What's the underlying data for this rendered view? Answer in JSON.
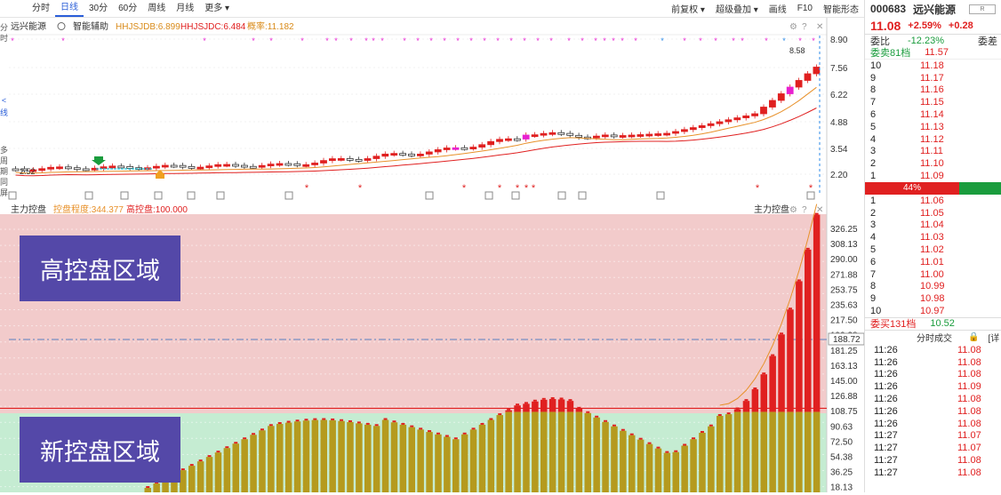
{
  "toolbar": {
    "tabs": [
      "分时",
      "日线",
      "30分",
      "60分",
      "周线",
      "月线",
      "更多"
    ],
    "active": 1,
    "right": [
      "前复权",
      "超级叠加",
      "画线",
      "F10",
      "智能形态"
    ]
  },
  "left_strip": [
    "分",
    "时",
    "<",
    "线",
    "多",
    "周",
    "期",
    "同",
    "屏"
  ],
  "indicator_bar": {
    "stock": "远兴能源",
    "assist": "智能辅助",
    "hhjsjdb": "HHJSJDB:6.899",
    "hhjsjdc": "HHJSJDC:6.484",
    "ratio": "概率:11.182"
  },
  "price_axis": [
    "8.90",
    "7.56",
    "6.22",
    "4.88",
    "3.54",
    "2.20"
  ],
  "price_marks": {
    "high_label": "8.58",
    "low_label": "2.52"
  },
  "sub_panel": {
    "title": "主力控盘",
    "degree": "控盘程度:344.377",
    "high": "高控盘:100.000",
    "right_title": "主力控盘",
    "axis": [
      "326.25",
      "308.13",
      "290.00",
      "271.88",
      "253.75",
      "235.63",
      "217.50",
      "199.38",
      "181.25",
      "163.13",
      "145.00",
      "126.88",
      "108.75",
      "90.63",
      "72.50",
      "54.38",
      "36.25",
      "18.13"
    ],
    "ref_value": "188.72",
    "high_zone_label": "高控盘区域",
    "new_zone_label": "新控盘区域"
  },
  "colors": {
    "up": "#e02020",
    "down": "#1a9c3d",
    "gold": "#b59a1e",
    "magenta": "#e820d0",
    "high_zone": "#f2cbcb",
    "new_zone": "#c5ecd2"
  },
  "quote": {
    "code": "000683",
    "name": "远兴能源",
    "r_button": "R",
    "price": "11.08",
    "pct": "+2.59%",
    "chg": "+0.28",
    "ratio_label": "委比",
    "ratio_value": "-12.23%",
    "ratio_right": "委差",
    "sell_label": "委卖81档",
    "sell_value": "11.57",
    "asks": [
      {
        "level": "10",
        "price": "11.18"
      },
      {
        "level": "9",
        "price": "11.17"
      },
      {
        "level": "8",
        "price": "11.16"
      },
      {
        "level": "7",
        "price": "11.15"
      },
      {
        "level": "6",
        "price": "11.14"
      },
      {
        "level": "5",
        "price": "11.13"
      },
      {
        "level": "4",
        "price": "11.12"
      },
      {
        "level": "3",
        "price": "11.11"
      },
      {
        "level": "2",
        "price": "11.10"
      },
      {
        "level": "1",
        "price": "11.09"
      }
    ],
    "balance_pct": "44%",
    "bids": [
      {
        "level": "1",
        "price": "11.06"
      },
      {
        "level": "2",
        "price": "11.05"
      },
      {
        "level": "3",
        "price": "11.04"
      },
      {
        "level": "4",
        "price": "11.03"
      },
      {
        "level": "5",
        "price": "11.02"
      },
      {
        "level": "6",
        "price": "11.01"
      },
      {
        "level": "7",
        "price": "11.00"
      },
      {
        "level": "8",
        "price": "10.99"
      },
      {
        "level": "9",
        "price": "10.98"
      },
      {
        "level": "10",
        "price": "10.97"
      }
    ],
    "buy_label": "委买131档",
    "buy_value": "10.52",
    "ticks_title": "分时成交",
    "ticks_extra": "[详",
    "ticks": [
      {
        "time": "11:26",
        "price": "11.08"
      },
      {
        "time": "11:26",
        "price": "11.08"
      },
      {
        "time": "11:26",
        "price": "11.08"
      },
      {
        "time": "11:26",
        "price": "11.09"
      },
      {
        "time": "11:26",
        "price": "11.08"
      },
      {
        "time": "11:26",
        "price": "11.08"
      },
      {
        "time": "11:26",
        "price": "11.08"
      },
      {
        "time": "11:27",
        "price": "11.07"
      },
      {
        "time": "11:27",
        "price": "11.07"
      },
      {
        "time": "11:27",
        "price": "11.08"
      },
      {
        "time": "11:27",
        "price": "11.08"
      }
    ]
  }
}
